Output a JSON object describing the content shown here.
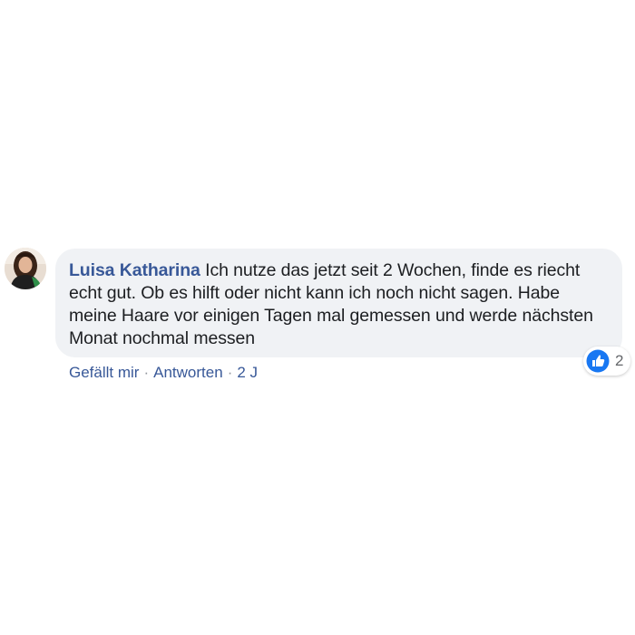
{
  "comment": {
    "author": "Luisa Katharina",
    "text": "Ich nutze das jetzt seit 2 Wochen, finde es riecht echt gut. Ob es hilft oder nicht kann ich noch nicht sagen. Habe meine Haare vor einigen Tagen mal gemessen und werde nächsten Monat nochmal messen",
    "reactions": {
      "icon": "thumbs-up-icon",
      "count": "2"
    },
    "actions": {
      "like_label": "Gefällt mir",
      "separator": "·",
      "reply_label": "Antworten",
      "timestamp": "2 J"
    }
  },
  "colors": {
    "author": "#385898",
    "bubble": "#f0f2f5",
    "text": "#1c1e21",
    "like_blue": "#1877f2",
    "muted": "#65676b"
  }
}
